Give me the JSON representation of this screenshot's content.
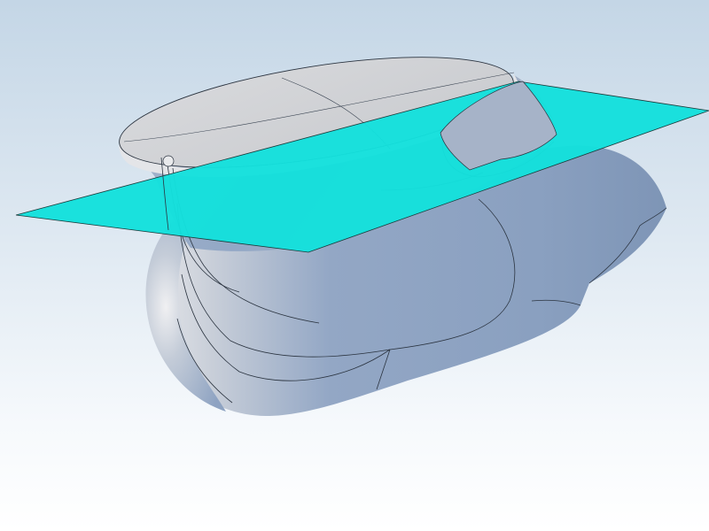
{
  "viewport": {
    "background_top": "#c4d6e6",
    "background_bottom": "#ffffff"
  },
  "model": {
    "body_color": "#8fa4c4",
    "body_highlight": "#d7dbe2",
    "top_face_color": "#d2d4d8",
    "edge_color": "#2b3440"
  },
  "section_plane": {
    "color": "#14e0dc",
    "edge_color": "#1a3a3a"
  }
}
